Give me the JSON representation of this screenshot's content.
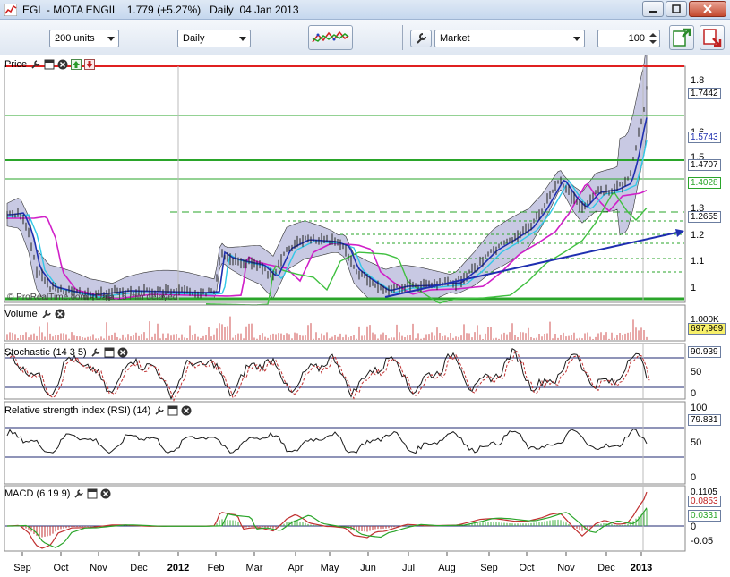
{
  "window": {
    "symbol": "EGL - MOTA ENGIL",
    "price": "1.779",
    "change": "(+5.27%)",
    "interval": "Daily",
    "date": "04 Jan 2013"
  },
  "toolbar": {
    "units_select": "200 units",
    "period_select": "Daily",
    "order_type_select": "Market",
    "quantity": "100"
  },
  "colors": {
    "price_bands": "#9a9ccc",
    "upper_red_line": "#e02020",
    "support_green": "#2aa52a",
    "trend_blue": "#1f2fb0",
    "ma_magenta": "#d020c8",
    "ma_cyan": "#30c8e8",
    "ma_green": "#40c040",
    "indicator_line": "#1a1a1a",
    "volume_bars": "#d05050"
  },
  "panels": {
    "price": {
      "title": "Price",
      "watermark": "© ProRealTime.com - Data 15 min delayed",
      "y_ticks": [
        "1.8",
        "1.7",
        "1.6",
        "1.5",
        "1.3",
        "1.2",
        "1.1",
        "1"
      ],
      "tags": [
        {
          "label": "1.7442",
          "style": "plain"
        },
        {
          "label": "1.5743",
          "style": "blue"
        },
        {
          "label": "1.4707",
          "style": "plain"
        },
        {
          "label": "1.4028",
          "style": "green"
        },
        {
          "label": "1.2655",
          "style": "plain"
        }
      ]
    },
    "volume": {
      "title": "Volume",
      "partial_tick": "1.000K",
      "tag": "697,969"
    },
    "stochastic": {
      "title": "Stochastic (14 3 5)",
      "y_ticks": [
        "50",
        "0"
      ],
      "tag": "90.939"
    },
    "rsi": {
      "title": "Relative strength index (RSI) (14)",
      "y_ticks": [
        "100",
        "50",
        "0"
      ],
      "tag": "79.831"
    },
    "macd": {
      "title": "MACD (6 19 9)",
      "y_ticks": [
        "0",
        "-0.05"
      ],
      "partial_tick": "0.1105",
      "tags": [
        {
          "label": "0.0853",
          "style": "red"
        },
        {
          "label": "0.0331",
          "style": "green"
        }
      ]
    }
  },
  "x_axis": {
    "labels": [
      "Sep",
      "Oct",
      "Nov",
      "Dec",
      "2012",
      "Feb",
      "Mar",
      "Apr",
      "May",
      "Jun",
      "Jul",
      "Aug",
      "Sep",
      "Oct",
      "Nov",
      "Dec",
      "2013"
    ]
  }
}
